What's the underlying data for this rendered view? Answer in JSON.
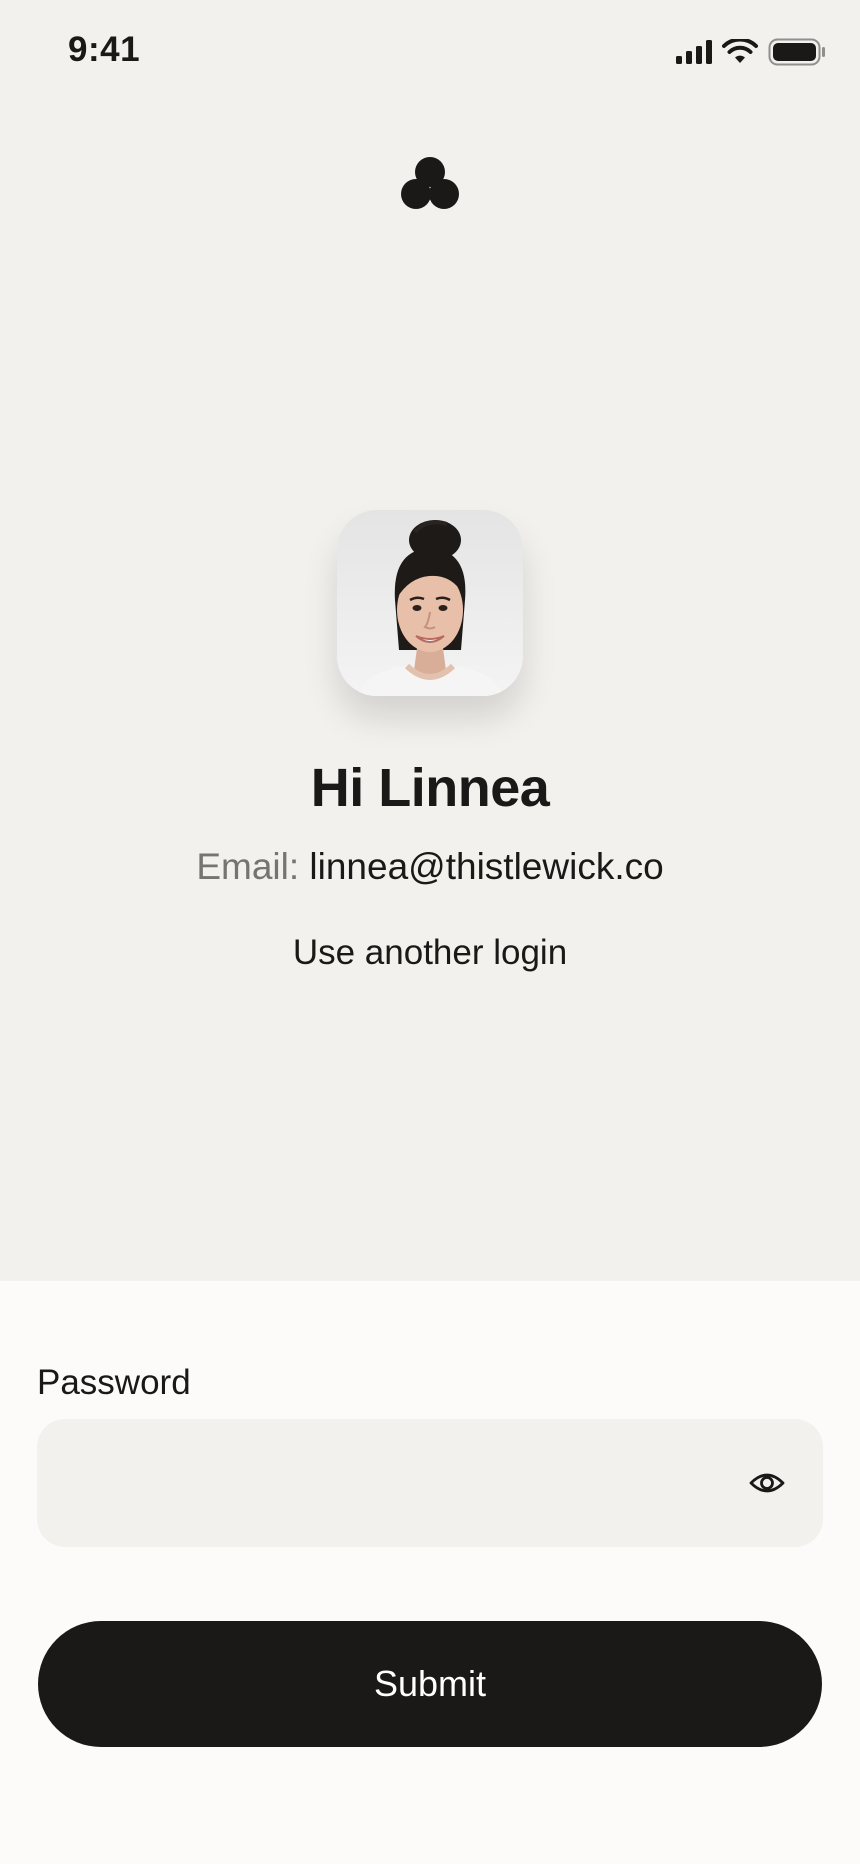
{
  "status_bar": {
    "time": "9:41",
    "icons": [
      "signal-icon",
      "wifi-icon",
      "battery-icon"
    ]
  },
  "logo": {
    "icon": "three-circles-logo-icon"
  },
  "profile": {
    "greeting": "Hi Linnea",
    "email_label": "Email:",
    "email_value": "linnea@thistlewick.co",
    "other_login_label": "Use another login"
  },
  "form": {
    "password_label": "Password",
    "password_value": "",
    "password_placeholder": "",
    "visibility_icon": "eye-icon",
    "submit_label": "Submit"
  },
  "colors": {
    "background": "#F2F1EE",
    "sheet": "#FCFBF9",
    "text": "#1A1918",
    "muted": "#77746F",
    "button": "#1A1918",
    "button_text": "#FFFFFF"
  }
}
